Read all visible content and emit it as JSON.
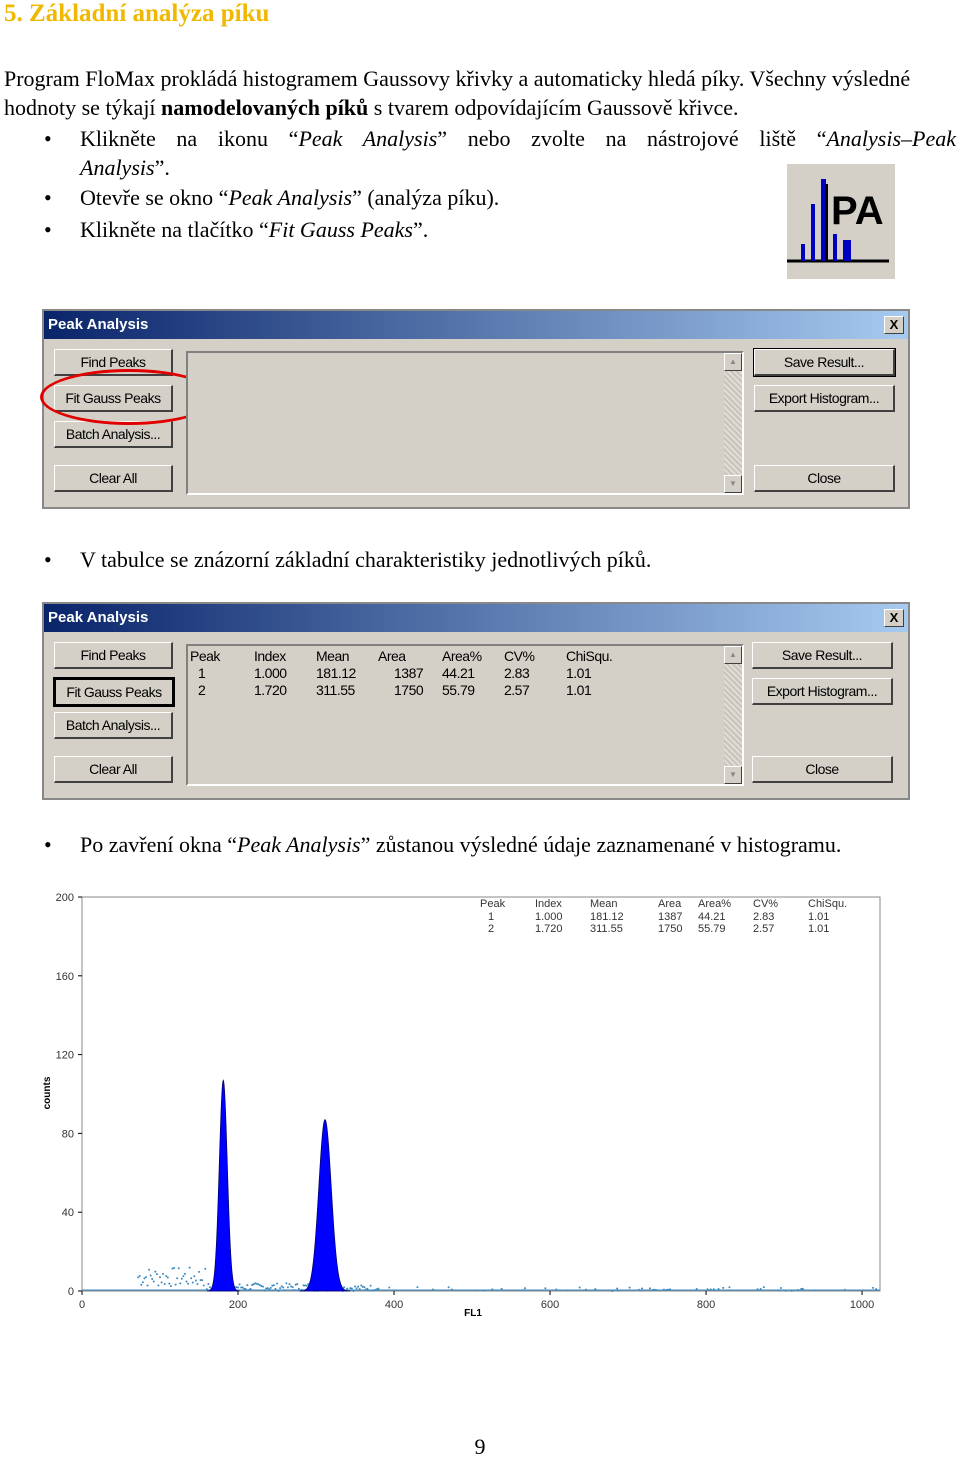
{
  "heading": "5. Základní analýza píku",
  "intro": {
    "before": "Program FloMax prokládá histogramem Gaussovy křivky a automaticky hledá píky. Všechny výsledné hodnoty se týkají ",
    "bold": "namodelovaných píků",
    "after": " s tvarem odpovídajícím Gaussově křivce."
  },
  "bullets": [
    {
      "a": "Klikněte na ikonu “",
      "i": "Peak Analysis",
      "b": "” nebo zvolte na nástrojové liště “",
      "i2": "Analysis–Peak",
      "line2i": "Analysis",
      "line2": "”."
    },
    {
      "a": "Otevře se okno “",
      "i": "Peak Analysis",
      "b": "” (analýza píku)."
    },
    {
      "a": "Klikněte na tlačítko “",
      "i": "Fit Gauss Peaks",
      "b": "”."
    },
    {
      "a": "V tabulce se znázorní základní charakteristiky jednotlivých píků."
    },
    {
      "a": "Po zavření okna “",
      "i": "Peak Analysis",
      "b": "” zůstanou výsledné údaje zaznamenané v histogramu."
    }
  ],
  "icon_label": "PA",
  "dialog": {
    "title": "Peak Analysis",
    "close": "X",
    "left_buttons": [
      "Find Peaks",
      "Fit Gauss Peaks",
      "Batch Analysis...",
      "Clear All"
    ],
    "right_buttons": [
      "Save Result...",
      "Export Histogram...",
      "Close"
    ],
    "highlight_color": "#e00000"
  },
  "table": {
    "headers": [
      "Peak",
      "Index",
      "Mean",
      "Area",
      "Area%",
      "CV%",
      "ChiSqu."
    ],
    "rows": [
      [
        "1",
        "1.000",
        "181.12",
        "1387",
        "44.21",
        "2.83",
        "1.01"
      ],
      [
        "2",
        "1.720",
        "311.55",
        "1750",
        "55.79",
        "2.57",
        "1.01"
      ]
    ]
  },
  "chart_data": {
    "type": "area",
    "xlabel": "FL1",
    "ylabel": "counts",
    "xlim": [
      0,
      1023
    ],
    "ylim": [
      0,
      200
    ],
    "xticks": [
      0,
      200,
      400,
      600,
      800,
      1000
    ],
    "yticks": [
      0,
      40,
      80,
      120,
      160,
      200
    ],
    "fill_color": "#0000ff",
    "point_color": "#3a8ac0",
    "peaks": [
      {
        "peak": 1,
        "mean": 181.12,
        "height": 107,
        "cv": 2.83
      },
      {
        "peak": 2,
        "mean": 311.55,
        "height": 87,
        "cv": 2.57
      }
    ]
  },
  "page_number": "9"
}
